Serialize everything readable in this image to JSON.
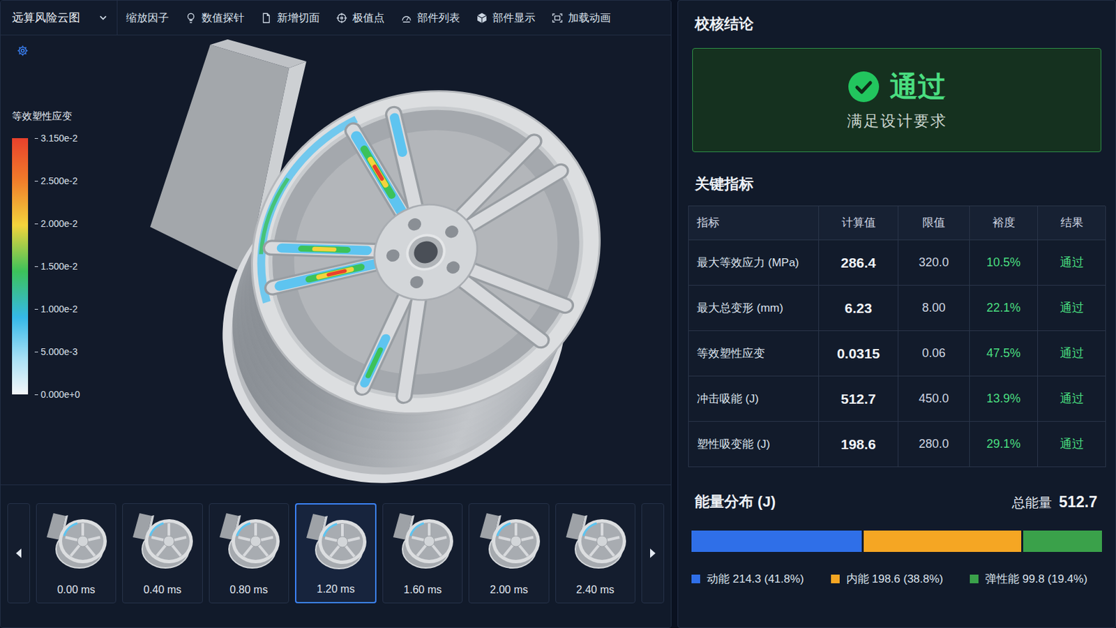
{
  "toolbar": {
    "view_selector": {
      "label": "远算风险云图"
    },
    "items": [
      {
        "label": "缩放因子"
      },
      {
        "label": "数值探针"
      },
      {
        "label": "新增切面"
      },
      {
        "label": "极值点"
      },
      {
        "label": "部件列表"
      },
      {
        "label": "部件显示"
      },
      {
        "label": "加载动画"
      }
    ]
  },
  "legend": {
    "title": "等效塑性应变",
    "ticks": [
      "3.150e-2",
      "2.500e-2",
      "2.000e-2",
      "1.500e-2",
      "1.000e-2",
      "5.000e-3",
      "0.000e+0"
    ]
  },
  "timeline": {
    "frames": [
      {
        "time": "0.00 ms",
        "selected": false
      },
      {
        "time": "0.40 ms",
        "selected": false
      },
      {
        "time": "0.80 ms",
        "selected": false
      },
      {
        "time": "1.20 ms",
        "selected": true
      },
      {
        "time": "1.60 ms",
        "selected": false
      },
      {
        "time": "2.00 ms",
        "selected": false
      },
      {
        "time": "2.40 ms",
        "selected": false
      }
    ]
  },
  "conclusion": {
    "title": "校核结论",
    "status": "通过",
    "passed": true,
    "description": "满足设计要求"
  },
  "metrics": {
    "title": "关键指标",
    "columns": [
      "指标",
      "计算值",
      "限值",
      "裕度",
      "结果"
    ],
    "rows": [
      {
        "cells": [
          "最大等效应力 (MPa)",
          "286.4",
          "320.0",
          "10.5%",
          "通过"
        ],
        "passed": true
      },
      {
        "cells": [
          "最大总变形 (mm)",
          "6.23",
          "8.00",
          "22.1%",
          "通过"
        ],
        "passed": true
      },
      {
        "cells": [
          "等效塑性应变",
          "0.0315",
          "0.06",
          "47.5%",
          "通过"
        ],
        "passed": true
      },
      {
        "cells": [
          "冲击吸能 (J)",
          "512.7",
          "450.0",
          "13.9%",
          "通过"
        ],
        "passed": true
      },
      {
        "cells": [
          "塑性吸变能 (J)",
          "198.6",
          "280.0",
          "29.1%",
          "通过"
        ],
        "passed": true
      }
    ]
  },
  "energy": {
    "title": "能量分布 (J)",
    "total_label": "总能量",
    "total": "512.7",
    "segments": [
      {
        "label": "动能 214.3 (41.8%)",
        "level": 0.418,
        "color": "#2f6fe8"
      },
      {
        "label": "内能 198.6 (38.8%)",
        "level": 0.388,
        "color": "#f5a623"
      },
      {
        "label": "弹性能 99.8 (19.4%)",
        "level": 0.194,
        "color": "#3aa14a"
      }
    ]
  }
}
